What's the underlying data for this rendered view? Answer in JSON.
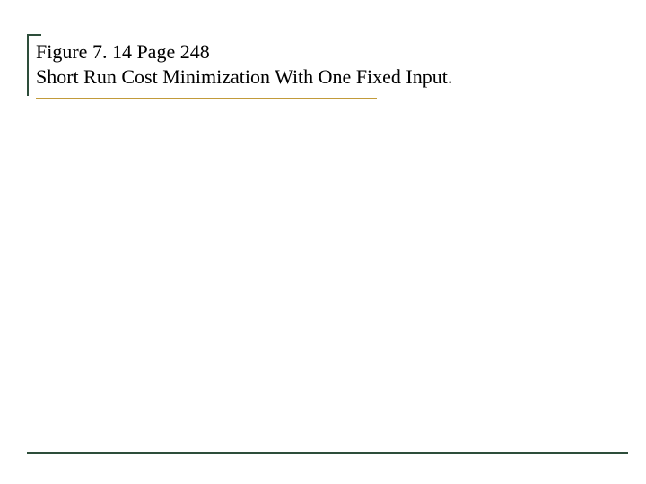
{
  "title": {
    "line1": "Figure 7. 14 Page 248",
    "line2": "Short Run Cost Minimization With One Fixed Input."
  }
}
